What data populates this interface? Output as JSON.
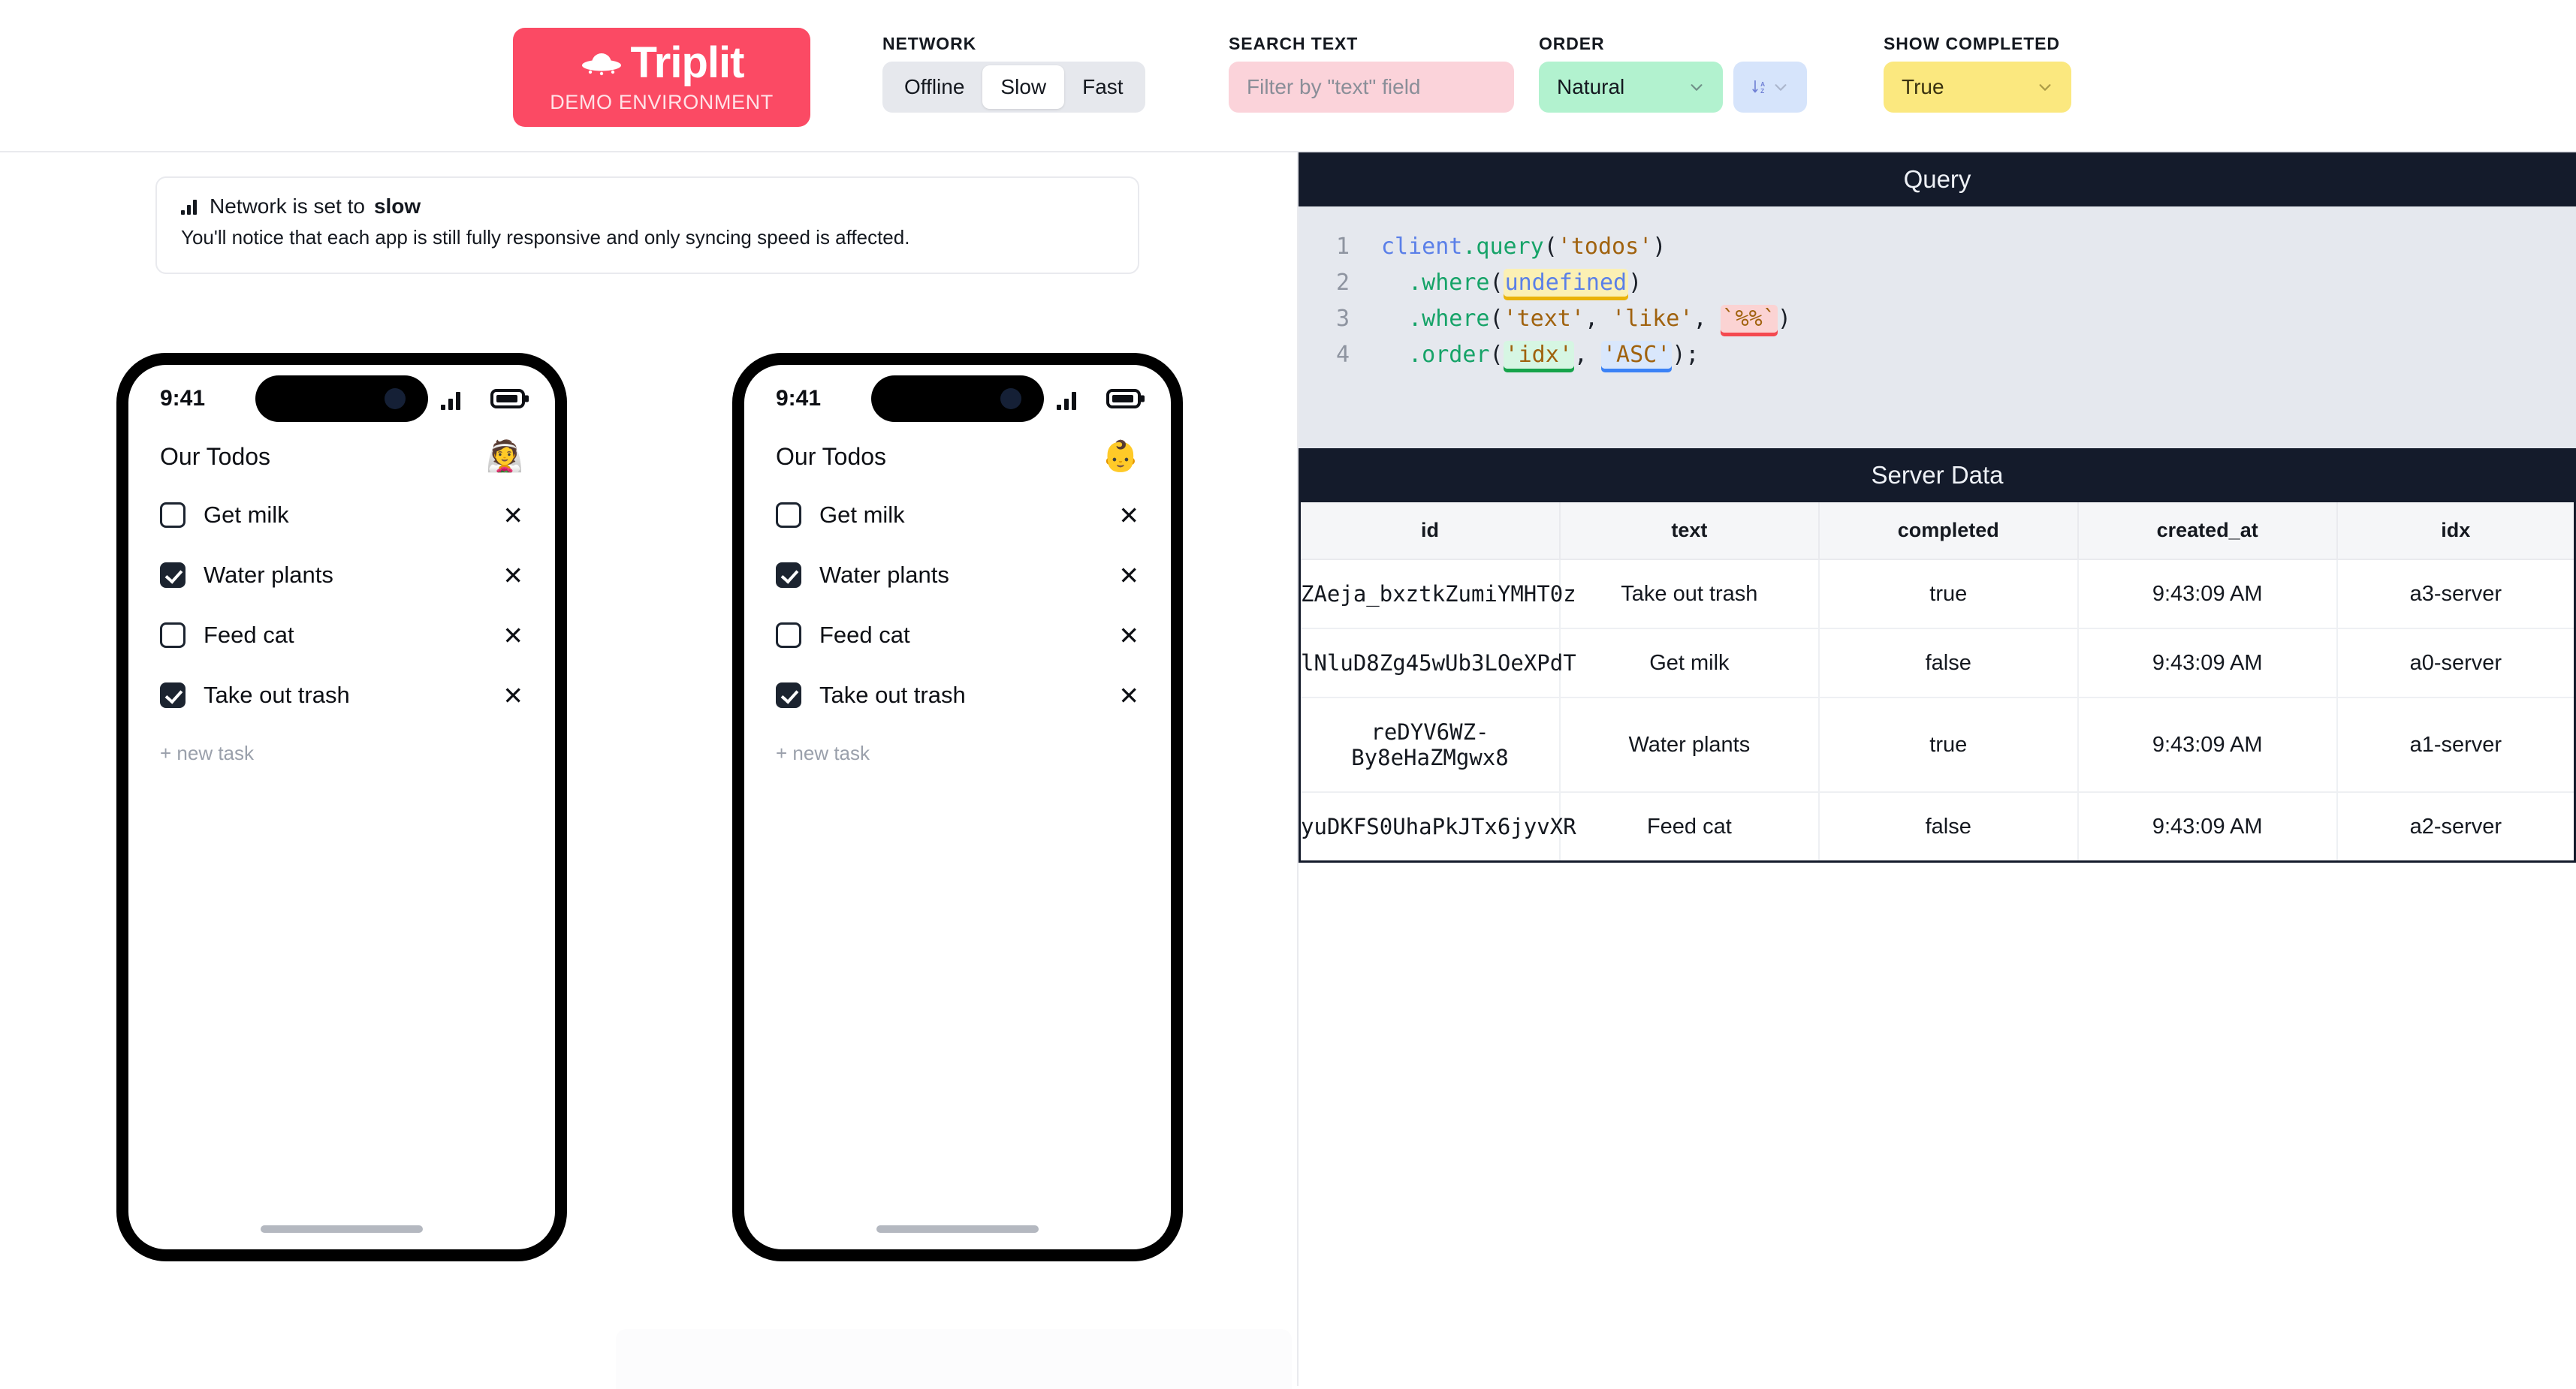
{
  "brand": {
    "name": "Triplit",
    "subtitle": "DEMO ENVIRONMENT",
    "logo_icon": "ufo-icon",
    "accent_color": "#fb4a64"
  },
  "controls": {
    "network": {
      "label": "NETWORK",
      "options": [
        "Offline",
        "Slow",
        "Fast"
      ],
      "selected": "Slow"
    },
    "search": {
      "label": "SEARCH TEXT",
      "placeholder": "Filter by \"text\" field",
      "value": "",
      "bg_color": "#fbd3da"
    },
    "order": {
      "label": "ORDER",
      "selected": "Natural",
      "bg_color": "#b2f2cf",
      "direction_icon": "sort-alpha-down-icon",
      "direction_bg": "#d6e4fb"
    },
    "show_completed": {
      "label": "SHOW COMPLETED",
      "selected": "True",
      "bg_color": "#fbe87f"
    }
  },
  "notice": {
    "icon": "signal-bars-icon",
    "title_prefix": "Network is set to ",
    "title_emphasis": "slow",
    "body": "You'll notice that each app is still fully responsive and only syncing speed is affected."
  },
  "phones": [
    {
      "status_time": "9:41",
      "app_title": "Our Todos",
      "avatar": "👰",
      "new_task_label": "+ new task",
      "todos": [
        {
          "text": "Get milk",
          "completed": false
        },
        {
          "text": "Water plants",
          "completed": true
        },
        {
          "text": "Feed cat",
          "completed": false
        },
        {
          "text": "Take out trash",
          "completed": true
        }
      ]
    },
    {
      "status_time": "9:41",
      "app_title": "Our Todos",
      "avatar": "👶",
      "new_task_label": "+ new task",
      "todos": [
        {
          "text": "Get milk",
          "completed": false
        },
        {
          "text": "Water plants",
          "completed": true
        },
        {
          "text": "Feed cat",
          "completed": false
        },
        {
          "text": "Take out trash",
          "completed": true
        }
      ]
    }
  ],
  "query_panel": {
    "title": "Query",
    "lines": [
      {
        "n": "1",
        "text": "client.query('todos')"
      },
      {
        "n": "2",
        "text": "  .where(undefined)"
      },
      {
        "n": "3",
        "text": "  .where('text', 'like', `%%`)"
      },
      {
        "n": "4",
        "text": "  .order('idx', 'ASC');"
      }
    ],
    "tokens": {
      "client": "client",
      "query_fn": ".query",
      "collection": "'todos'",
      "where_fn": ".where",
      "undefined": "undefined",
      "field_text": "'text'",
      "op_like": "'like'",
      "pattern": "`%%`",
      "order_fn": ".order",
      "field_idx": "'idx'",
      "dir_asc": "'ASC'"
    }
  },
  "server_panel": {
    "title": "Server Data",
    "columns": [
      "id",
      "text",
      "completed",
      "created_at",
      "idx"
    ],
    "rows": [
      {
        "id": "ZAeja_bxztkZumiYMHT0z",
        "text": "Take out trash",
        "completed": "true",
        "created_at": "9:43:09 AM",
        "idx": "a3-server"
      },
      {
        "id": "lNluD8Zg45wUb3LOeXPdT",
        "text": "Get milk",
        "completed": "false",
        "created_at": "9:43:09 AM",
        "idx": "a0-server"
      },
      {
        "id": "reDYV6WZ-By8eHaZMgwx8",
        "text": "Water plants",
        "completed": "true",
        "created_at": "9:43:09 AM",
        "idx": "a1-server"
      },
      {
        "id": "yuDKFS0UhaPkJTx6jyvXR",
        "text": "Feed cat",
        "completed": "false",
        "created_at": "9:43:09 AM",
        "idx": "a2-server"
      }
    ]
  }
}
